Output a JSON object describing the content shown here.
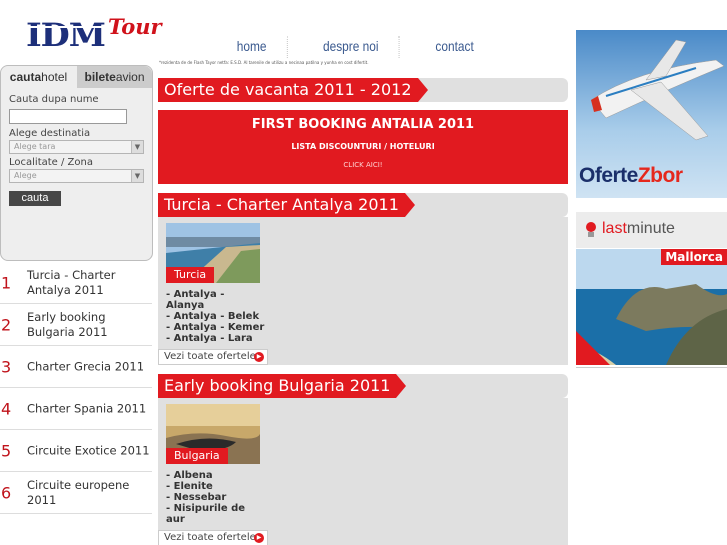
{
  "header": {
    "logo_text": "IDM",
    "logo_sub": "Tour",
    "nav": [
      "home",
      "despre noi",
      "contact"
    ],
    "tiny_text": "*rezidenta de de Flash Tayor netfa: E.S.D. Al tarenile de utilizu a necinaa patilna y yunha en cost difertit."
  },
  "search": {
    "tab_hotel_a": "cauta",
    "tab_hotel_b": "hotel",
    "tab_avion_a": "bilete",
    "tab_avion_b": "avion",
    "label_name": "Cauta dupa nume",
    "label_dest": "Alege destinatia",
    "select_dest": "Alege tara",
    "label_loc": "Localitate / Zona",
    "select_loc": "Alege",
    "button": "cauta"
  },
  "left_list": [
    {
      "num": "1",
      "label": "Turcia - Charter Antalya 2011"
    },
    {
      "num": "2",
      "label": "Early booking Bulgaria 2011"
    },
    {
      "num": "3",
      "label": "Charter Grecia 2011"
    },
    {
      "num": "4",
      "label": "Charter Spania 2011"
    },
    {
      "num": "5",
      "label": "Circuite Exotice 2011"
    },
    {
      "num": "6",
      "label": "Circuite europene 2011"
    }
  ],
  "main": {
    "offers_title": "Oferte de vacanta 2011 - 2012",
    "promo": {
      "headline": "FIRST BOOKING ANTALIA 2011",
      "sub": "LISTA DISCOUNTURI / HOTELURI",
      "click": "CLICK AICI!"
    },
    "sections": [
      {
        "title": "Turcia - Charter Antalya 2011",
        "caption": "Turcia",
        "cities": [
          "- Antalya - Alanya",
          "- Antalya - Belek",
          "- Antalya - Kemer",
          "- Antalya - Lara"
        ],
        "link": "Vezi toate ofertele"
      },
      {
        "title": "Early booking Bulgaria 2011",
        "caption": "Bulgaria",
        "cities": [
          "- Albena",
          "- Elenite",
          "- Nessebar",
          "- Nisipurile de aur"
        ],
        "link": "Vezi toate ofertele"
      }
    ]
  },
  "right": {
    "zbor_a": "Oferte",
    "zbor_b": "Zbor",
    "last_a": "last",
    "last_b": "minute",
    "mallorca": "Mallorca",
    "badge": "Last Minute"
  },
  "colors": {
    "accent": "#e11a20",
    "brand_blue": "#1d2f7a",
    "panel_gray": "#e0e0e0"
  }
}
